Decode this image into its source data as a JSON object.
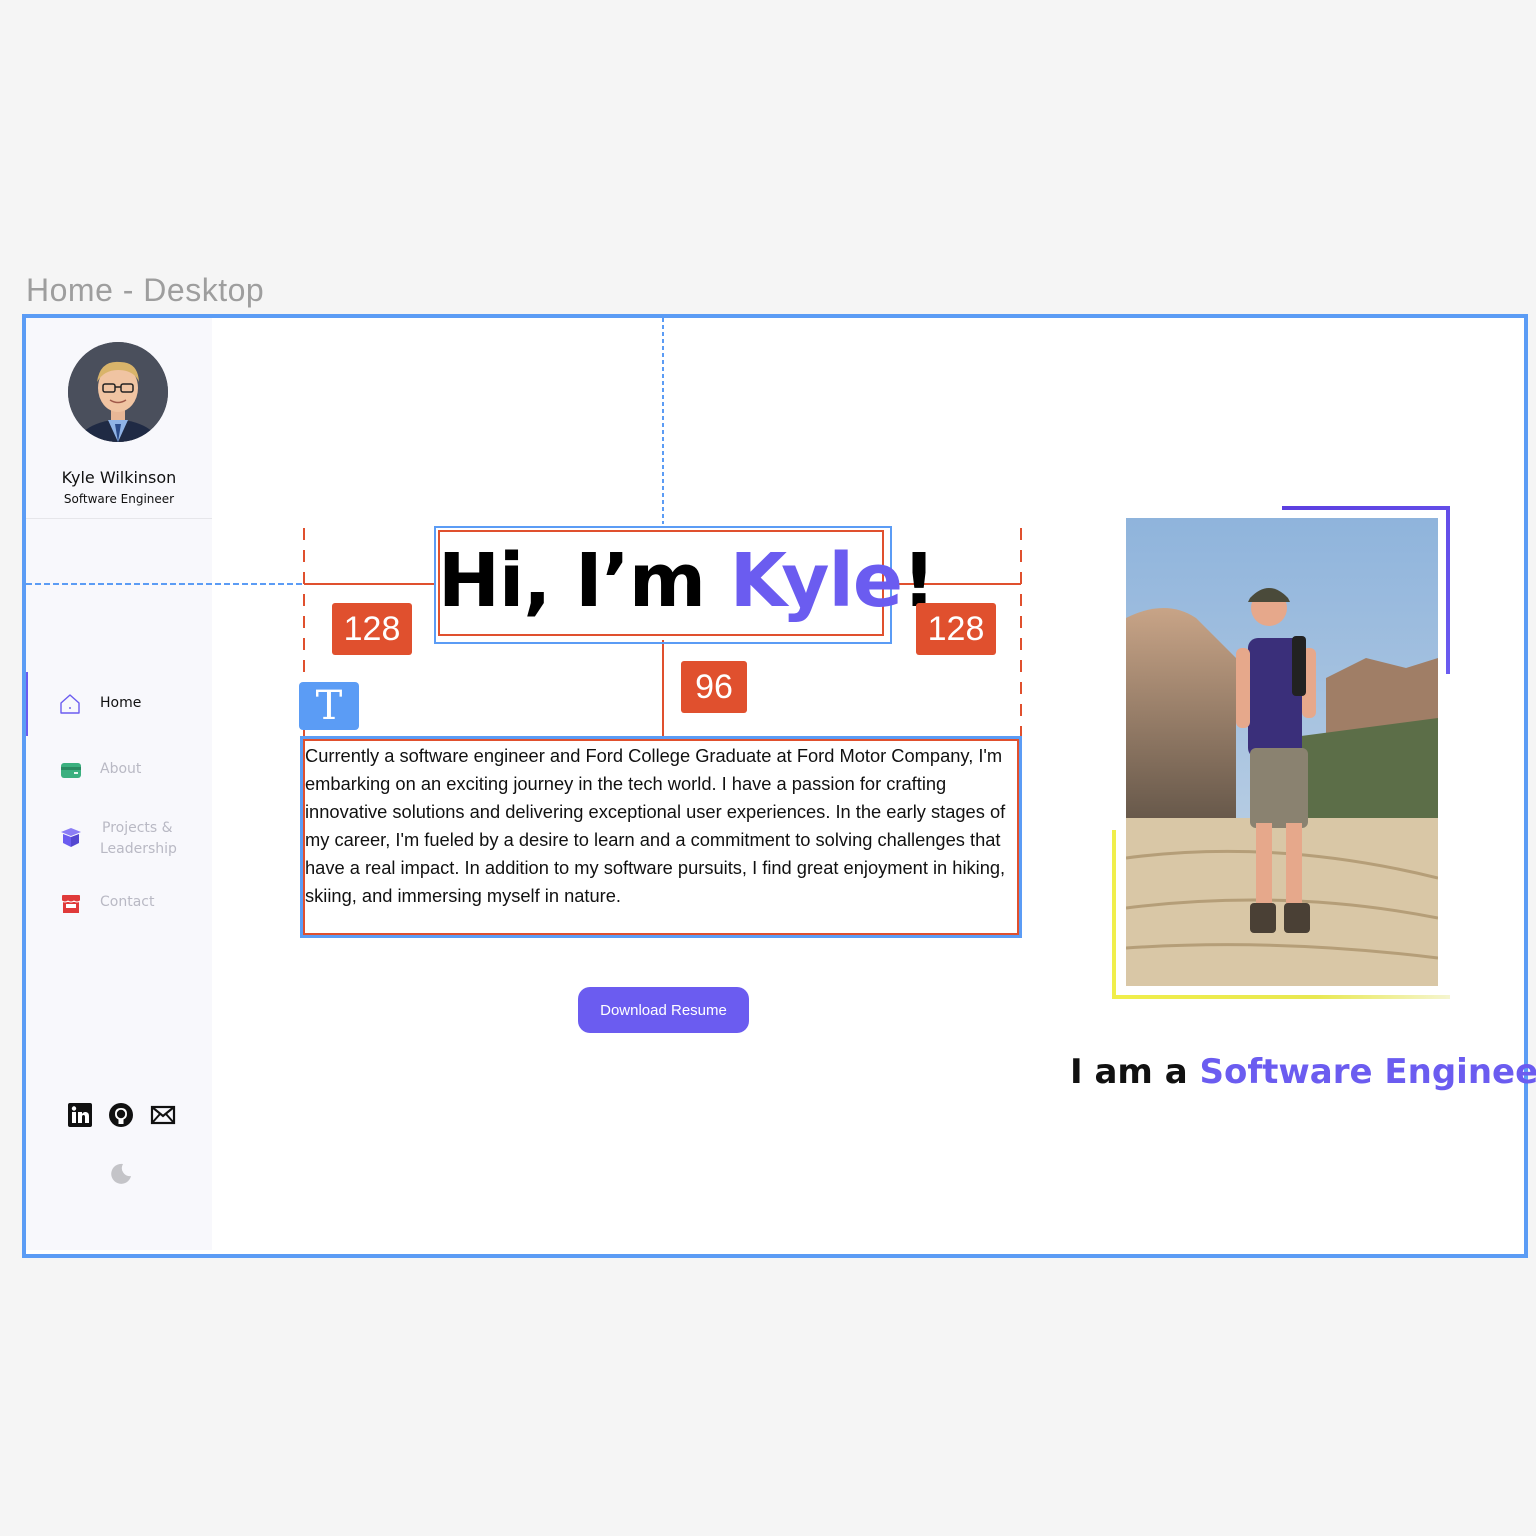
{
  "canvas": {
    "frame_label": "Home - Desktop"
  },
  "sidebar": {
    "name": "Kyle Wilkinson",
    "role": "Software Engineer",
    "nav": [
      {
        "label": "Home",
        "icon": "home-icon",
        "active": true
      },
      {
        "label": "About",
        "icon": "card-icon",
        "active": false
      },
      {
        "label_line1": "Projects &",
        "label_line2": "Leadership",
        "icon": "box-icon",
        "active": false
      },
      {
        "label": "Contact",
        "icon": "store-icon",
        "active": false
      }
    ],
    "social": [
      "linkedin-icon",
      "github-icon",
      "mail-icon"
    ],
    "theme_toggle": "moon-icon"
  },
  "hero": {
    "greeting": "Hi, I’m ",
    "name": "Kyle",
    "punct": "!",
    "paragraph": "Currently a software engineer and Ford College Graduate at Ford Motor Company, I'm embarking on an exciting journey in the tech world. I have a passion for crafting innovative solutions and delivering exceptional user experiences. In the early stages of my career, I'm fueled by a desire to learn and a commitment to solving challenges that have a real impact.  In addition to my software pursuits, I find great enjoyment in hiking, skiing, and immersing myself in nature.",
    "button": "Download Resume"
  },
  "tagline": {
    "prefix": "I am a ",
    "highlight": "Software Engineer"
  },
  "measurements": {
    "left": "128",
    "right": "128",
    "gap": "96"
  },
  "colors": {
    "accent": "#6b5cf0",
    "selection": "#5b9cf5",
    "spacing": "#e0502e"
  }
}
